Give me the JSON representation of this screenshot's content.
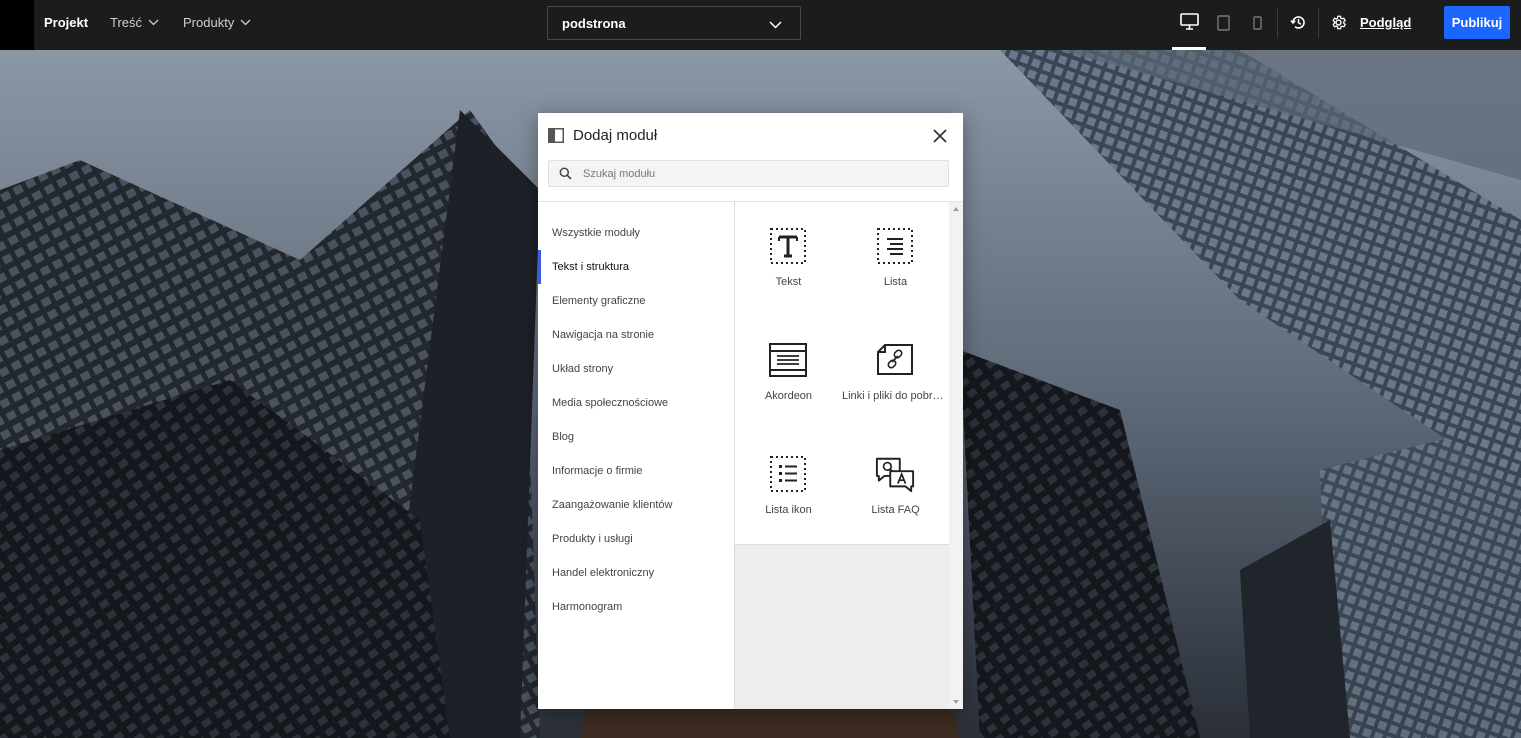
{
  "topbar": {
    "nav": [
      {
        "label": "Projekt"
      },
      {
        "label": "Treść"
      },
      {
        "label": "Produkty"
      }
    ],
    "page_select": {
      "value": "podstrona"
    },
    "preview_label": "Podgląd",
    "publish_label": "Publikuj",
    "icons": [
      "desktop-icon",
      "tablet-icon",
      "mobile-icon",
      "history-icon",
      "gear-icon"
    ]
  },
  "modal": {
    "title": "Dodaj moduł",
    "search_placeholder": "Szukaj modułu",
    "categories": [
      {
        "label": "Wszystkie moduły"
      },
      {
        "label": "Tekst i struktura",
        "active": true
      },
      {
        "label": "Elementy graficzne"
      },
      {
        "label": "Nawigacja na stronie"
      },
      {
        "label": "Układ strony"
      },
      {
        "label": "Media społecznościowe"
      },
      {
        "label": "Blog"
      },
      {
        "label": "Informacje o firmie"
      },
      {
        "label": "Zaangażowanie klientów"
      },
      {
        "label": "Produkty i usługi"
      },
      {
        "label": "Handel elektroniczny"
      },
      {
        "label": "Harmonogram"
      }
    ],
    "modules": [
      {
        "label": "Tekst",
        "icon": "text-icon"
      },
      {
        "label": "Lista",
        "icon": "list-icon"
      },
      {
        "label": "Akordeon",
        "icon": "accordion-icon"
      },
      {
        "label": "Linki i pliki do pobrania",
        "icon": "links-files-icon"
      },
      {
        "label": "Lista ikon",
        "icon": "icon-list-icon"
      },
      {
        "label": "Lista FAQ",
        "icon": "faq-icon"
      }
    ]
  },
  "colors": {
    "topbar": "#1c1c1c",
    "publish": "#1a66ff",
    "active_category": "#3b5bdb"
  }
}
